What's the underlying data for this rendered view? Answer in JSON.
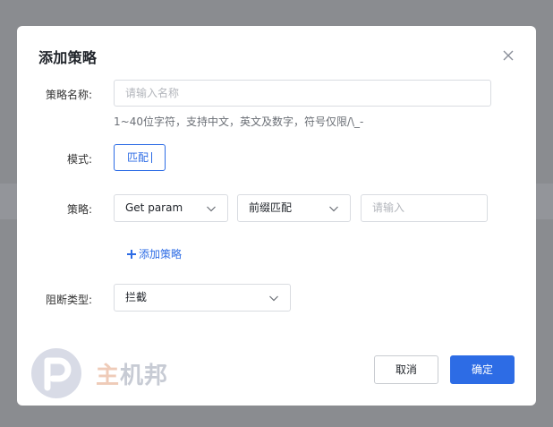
{
  "dialog": {
    "title": "添加策略"
  },
  "form": {
    "name_label": "策略名称:",
    "name_placeholder": "请输入名称",
    "name_help": "1~40位字符，支持中文，英文及数字，符号仅限/\\_-",
    "mode_label": "模式:",
    "mode_value": "匹配",
    "strategy_label": "策略:",
    "strategy_field": "Get param",
    "strategy_match": "前缀匹配",
    "strategy_value_placeholder": "请输入",
    "add_strategy": "添加策略",
    "block_label": "阻断类型:",
    "block_type": "拦截"
  },
  "footer": {
    "cancel": "取消",
    "confirm": "确定"
  },
  "watermark": {
    "first": "主",
    "rest": "机邦"
  },
  "colors": {
    "accent": "#2d6ce5",
    "backdrop": "#8a8c90"
  }
}
